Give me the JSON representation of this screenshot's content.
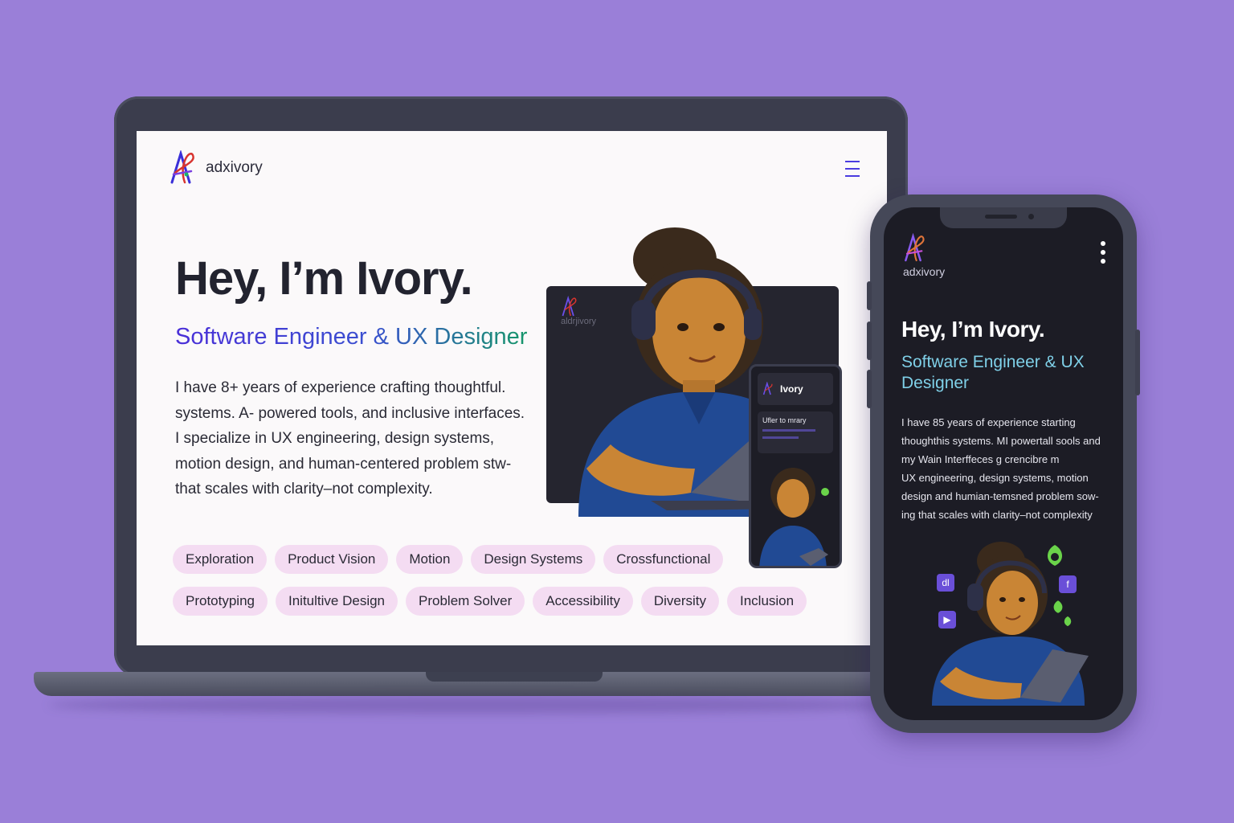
{
  "colors": {
    "background": "#9a7fd8",
    "accent": "#4a2fd8",
    "tag_bg": "#f4dcf2",
    "phone_subtitle": "#7fd0e8"
  },
  "desktop": {
    "brand": "adxivory",
    "title": "Hey, I’m Ivory.",
    "subtitle": "Software Engineer & UX Designer",
    "bio_lines": [
      "I have 8+ years of experience crafting thoughtful.",
      "systems. A- powered tools, and inclusive interfaces.",
      "I specialize in UX engineering, design systems,",
      "motion design, and human-centered problem stw-",
      "that scales with clarity–not complexity."
    ],
    "tags_row1": [
      "Exploration",
      "Product Vision",
      "Motion",
      "Design Systems",
      "Crossfunctional"
    ],
    "tags_row2": [
      "Prototyping",
      "Initultive Design",
      "Problem Solver",
      "Accessibility",
      "Diversity",
      "Inclusion"
    ],
    "menu_icon": "hamburger-icon",
    "illustration": {
      "card_brand": "aldrjivory",
      "mini_phone_name": "Ivory",
      "mini_phone_card_text": "Ufler to mrary"
    }
  },
  "mobile": {
    "brand": "adxivory",
    "title": "Hey, I’m Ivory.",
    "subtitle": "Software Engineer & UX Designer",
    "bio_lines": [
      "I have 85 years of experience starting",
      "thoughthis systems. MI powertall sools and",
      "my Wain Interffeces g crencibre m",
      "UX engineering, design systems, motion",
      "design and humian-temsned problem sow-",
      "ing that scales with clarity–not complexity"
    ],
    "menu_icon": "kebab-icon",
    "badges": [
      "dl",
      "f"
    ]
  }
}
